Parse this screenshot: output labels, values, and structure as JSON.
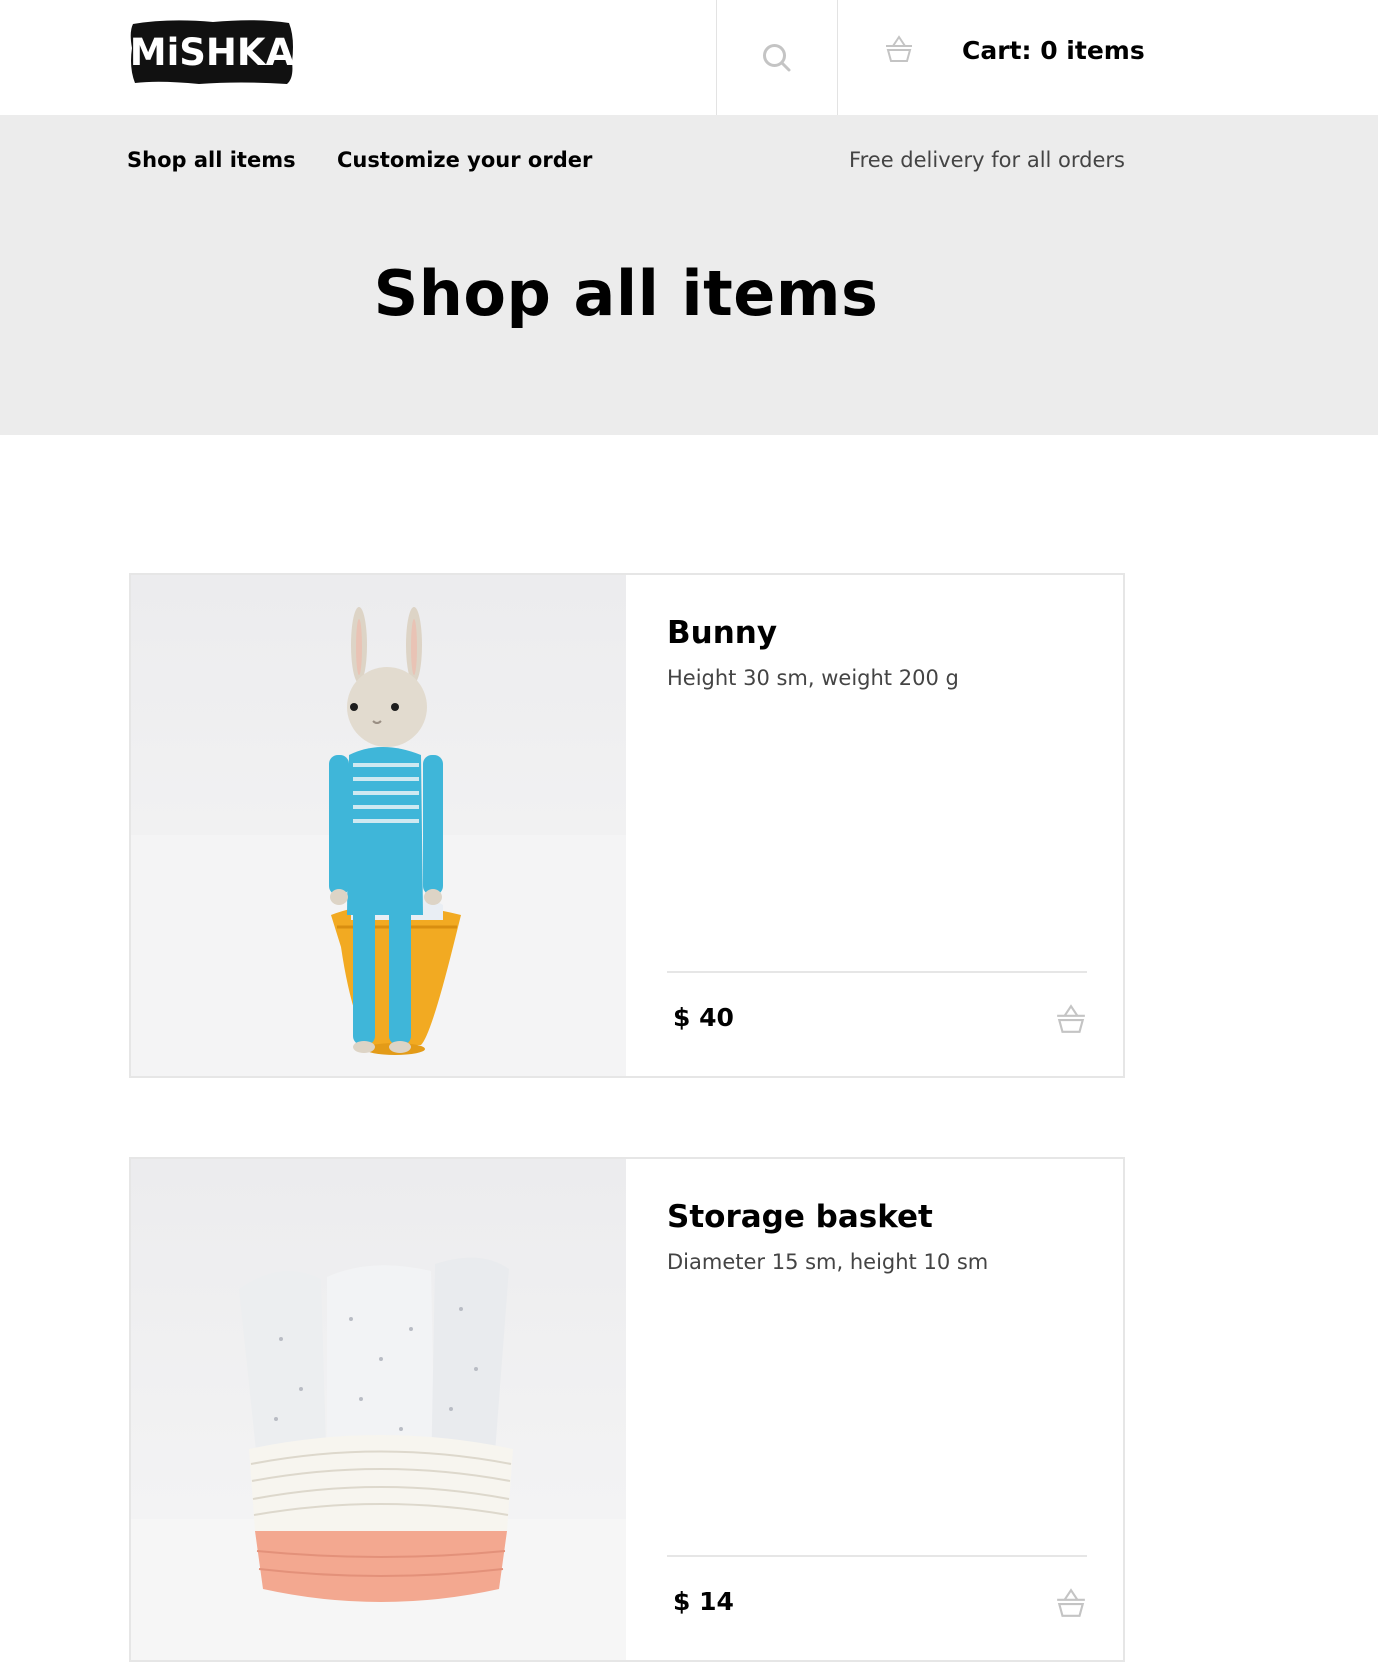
{
  "header": {
    "logo_text": "MiSHKA",
    "search_icon": "search-icon",
    "cart_icon": "basket-icon",
    "cart_label": "Cart: 0 items"
  },
  "nav": {
    "items": [
      {
        "label": "Shop all items"
      },
      {
        "label": "Customize your order"
      }
    ],
    "delivery_note": "Free delivery for all orders"
  },
  "page": {
    "title": "Shop all items"
  },
  "products": [
    {
      "name": "Bunny",
      "description": "Height 30 sm, weight 200 g",
      "price": "$ 40",
      "cart_icon": "basket-icon"
    },
    {
      "name": "Storage basket",
      "description": "Diameter 15 sm, height 10 sm",
      "price": "$ 14",
      "cart_icon": "basket-icon"
    }
  ],
  "colors": {
    "band_background": "#ececec",
    "text": "#000000",
    "muted_text": "#444444",
    "border": "#e6e6e6"
  }
}
